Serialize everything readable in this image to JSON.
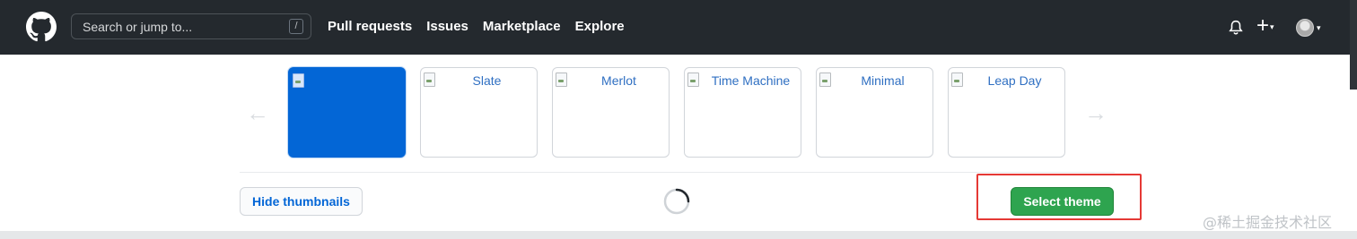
{
  "header": {
    "search_placeholder": "Search or jump to...",
    "search_shortcut": "/",
    "nav": [
      "Pull requests",
      "Issues",
      "Marketplace",
      "Explore"
    ],
    "add_label": "+",
    "caret": "▾"
  },
  "carousel": {
    "prev_arrow": "←",
    "next_arrow": "→",
    "themes": [
      {
        "label": "",
        "selected": true
      },
      {
        "label": "Slate",
        "selected": false
      },
      {
        "label": "Merlot",
        "selected": false
      },
      {
        "label": "Time Machine",
        "selected": false
      },
      {
        "label": "Minimal",
        "selected": false
      },
      {
        "label": "Leap Day",
        "selected": false
      }
    ]
  },
  "actions": {
    "hide_thumbnails": "Hide thumbnails",
    "select_theme": "Select theme"
  },
  "watermark": "@稀土掘金技术社区",
  "colors": {
    "header_bg": "#24292e",
    "accent_blue": "#0366d6",
    "success_green": "#2ea44f",
    "highlight_red": "#e53935"
  }
}
